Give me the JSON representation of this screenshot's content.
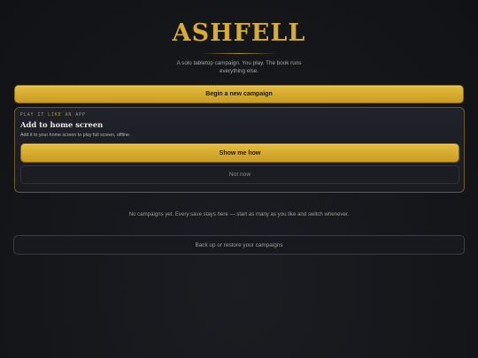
{
  "app": {
    "title": "ASHFELL",
    "tagline": "A solo tabletop campaign. You play. The book runs everything else."
  },
  "actions": {
    "begin_label": "Begin a new campaign",
    "backup_label": "Back up or restore your campaigns"
  },
  "install_card": {
    "eyebrow": "PLAY IT LIKE AN APP",
    "title": "Add to home screen",
    "description": "Add it to your home screen to play full screen, offline.",
    "show_label": "Show me how",
    "dismiss_label": "Not now"
  },
  "empty_state": {
    "message": "No campaigns yet. Every save stays here — start as many as you like and switch whenever."
  },
  "colors": {
    "accent_gold": "#d8ac34",
    "background": "#15171b",
    "card_border": "#6b5a2a"
  }
}
